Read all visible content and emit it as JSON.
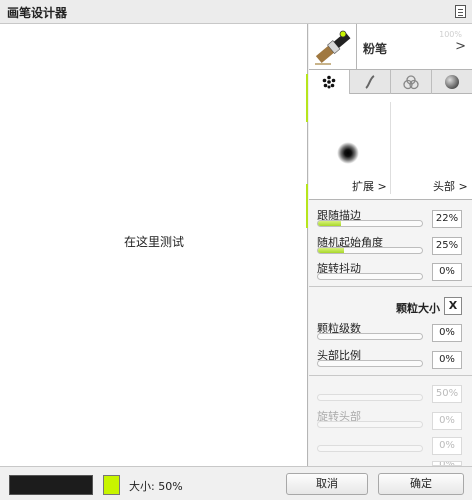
{
  "window": {
    "title": "画笔设计器"
  },
  "canvas": {
    "hint": "在这里测试"
  },
  "brush": {
    "name": "粉笔",
    "faint_text": "100%"
  },
  "tabs": [
    {
      "name": "tab-dots",
      "icon": "dots-icon",
      "active": true
    },
    {
      "name": "tab-stroke",
      "icon": "stroke-icon",
      "active": false
    },
    {
      "name": "tab-blend",
      "icon": "blend-icon",
      "active": false
    },
    {
      "name": "tab-sphere",
      "icon": "sphere-icon",
      "active": false
    }
  ],
  "preview": {
    "spread_label": "扩展 >",
    "head_label": "头部 >"
  },
  "section1": {
    "rows": [
      {
        "label": "跟随描边",
        "value": "22%",
        "fill": 0.22
      },
      {
        "label": "随机起始角度",
        "value": "25%",
        "fill": 0.25
      },
      {
        "label": "旋转抖动",
        "value": "0%",
        "fill": 0.0
      }
    ]
  },
  "section2": {
    "title": "颗粒大小",
    "close_label": "X",
    "rows": [
      {
        "label": "颗粒级数",
        "value": "0%",
        "fill": 0.0
      },
      {
        "label": "头部比例",
        "value": "0%",
        "fill": 0.0
      }
    ]
  },
  "section3": {
    "first_value": "50%",
    "rotate_label": "旋转头部",
    "values": [
      "0%",
      "0%",
      "0%"
    ]
  },
  "footer": {
    "size_label": "大小: 50%",
    "cancel_label": "取消",
    "ok_label": "确定",
    "primary_color": "#1c1c1c",
    "secondary_color": "#c8f500"
  }
}
